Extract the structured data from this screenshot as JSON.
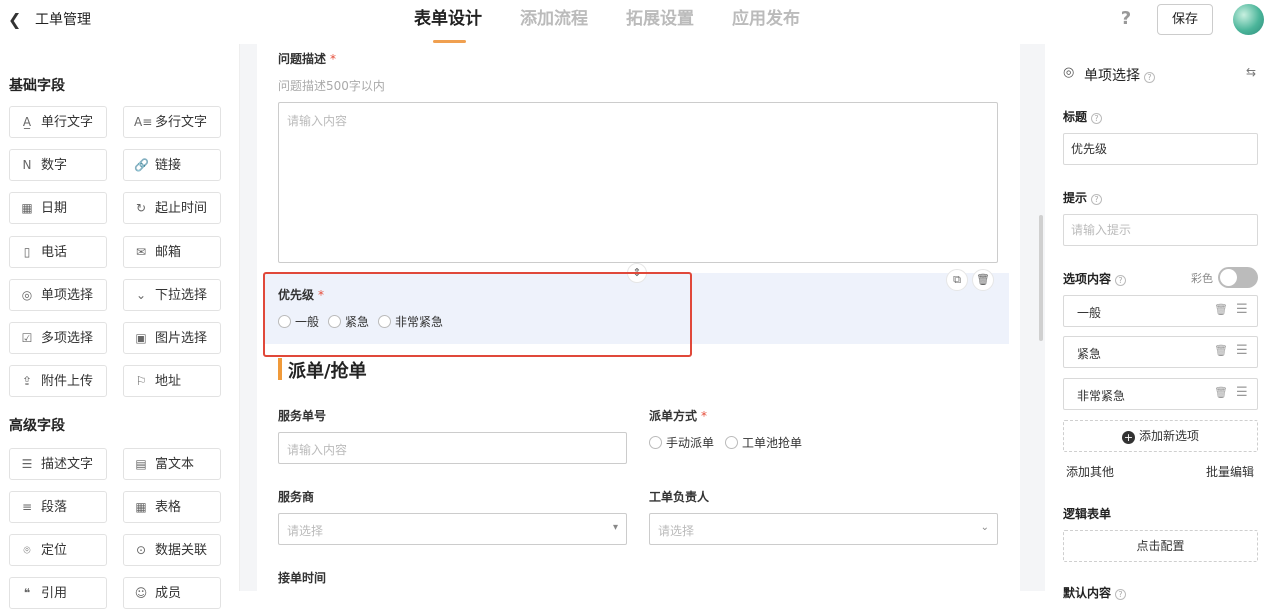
{
  "header": {
    "back_icon": "chevron-left-icon",
    "app_title": "工单管理",
    "tabs": [
      {
        "label": "表单设计",
        "active": true
      },
      {
        "label": "添加流程",
        "active": false
      },
      {
        "label": "拓展设置",
        "active": false
      },
      {
        "label": "应用发布",
        "active": false
      }
    ],
    "help_icon": "?",
    "save_label": "保存",
    "accent_color": "#f0a050"
  },
  "left": {
    "basic_title": "基础字段",
    "basic_fields": [
      {
        "label": "单行文字",
        "glyph": "A̲"
      },
      {
        "label": "多行文字",
        "glyph": "A≡"
      },
      {
        "label": "数字",
        "glyph": "N"
      },
      {
        "label": "链接",
        "glyph": "🔗"
      },
      {
        "label": "日期",
        "glyph": "▦"
      },
      {
        "label": "起止时间",
        "glyph": "↻"
      },
      {
        "label": "电话",
        "glyph": "▯"
      },
      {
        "label": "邮箱",
        "glyph": "✉"
      },
      {
        "label": "单项选择",
        "glyph": "◎"
      },
      {
        "label": "下拉选择",
        "glyph": "⌄"
      },
      {
        "label": "多项选择",
        "glyph": "☑"
      },
      {
        "label": "图片选择",
        "glyph": "▣"
      },
      {
        "label": "附件上传",
        "glyph": "⇪"
      },
      {
        "label": "地址",
        "glyph": "⚐"
      }
    ],
    "advanced_title": "高级字段",
    "advanced_fields": [
      {
        "label": "描述文字",
        "glyph": "☰"
      },
      {
        "label": "富文本",
        "glyph": "▤"
      },
      {
        "label": "段落",
        "glyph": "≡"
      },
      {
        "label": "表格",
        "glyph": "▦"
      },
      {
        "label": "定位",
        "glyph": "⌾"
      },
      {
        "label": "数据关联",
        "glyph": "⊙"
      },
      {
        "label": "引用",
        "glyph": "❝"
      },
      {
        "label": "成员",
        "glyph": "☺"
      }
    ]
  },
  "canvas": {
    "problem": {
      "label": "问题描述",
      "required": "*",
      "hint": "问题描述500字以内",
      "placeholder": "请输入内容"
    },
    "priority": {
      "label": "优先级",
      "required": "*",
      "options": [
        "一般",
        "紧急",
        "非常紧急"
      ],
      "copy_icon": "⧉",
      "delete_icon": "🗑",
      "move_icon": "⇕"
    },
    "section_title": "派单/抢单",
    "service_no": {
      "label": "服务单号",
      "placeholder": "请输入内容"
    },
    "dispatch": {
      "label": "派单方式",
      "required": "*",
      "options": [
        "手动派单",
        "工单池抢单"
      ]
    },
    "provider": {
      "label": "服务商",
      "placeholder": "请选择"
    },
    "owner": {
      "label": "工单负责人",
      "placeholder": "请选择"
    },
    "accept_time": {
      "label": "接单时间"
    },
    "selected_color": "#eef2fb",
    "highlight_color": "#e0483a"
  },
  "right": {
    "title_icon": "◎",
    "title": "单项选择",
    "swap_icon": "⇆",
    "title_label": "标题",
    "title_value": "优先级",
    "hint_label": "提示",
    "hint_placeholder": "请输入提示",
    "options_label": "选项内容",
    "color_label": "彩色",
    "color_on": false,
    "options": [
      "一般",
      "紧急",
      "非常紧急"
    ],
    "delete_icon": "🗑",
    "drag_icon": "☰",
    "add_option_label": "添加新选项",
    "add_other_label": "添加其他",
    "batch_edit_label": "批量编辑",
    "logic_label": "逻辑表单",
    "logic_button": "点击配置",
    "next_label": "默认内容"
  }
}
